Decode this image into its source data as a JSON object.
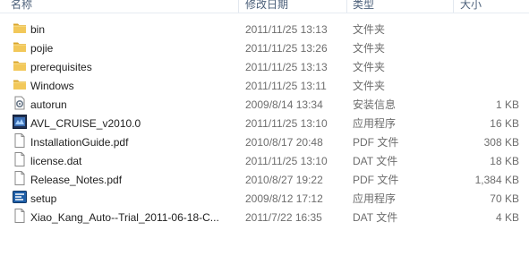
{
  "columns": {
    "name": "名称",
    "date": "修改日期",
    "type": "类型",
    "size": "大小"
  },
  "files": [
    {
      "name": "bin",
      "date": "2011/11/25 13:13",
      "type": "文件夹",
      "size": "",
      "icon": "folder-icon"
    },
    {
      "name": "pojie",
      "date": "2011/11/25 13:26",
      "type": "文件夹",
      "size": "",
      "icon": "folder-icon"
    },
    {
      "name": "prerequisites",
      "date": "2011/11/25 13:13",
      "type": "文件夹",
      "size": "",
      "icon": "folder-icon"
    },
    {
      "name": "Windows",
      "date": "2011/11/25 13:11",
      "type": "文件夹",
      "size": "",
      "icon": "folder-icon"
    },
    {
      "name": "autorun",
      "date": "2009/8/14 13:34",
      "type": "安装信息",
      "size": "1 KB",
      "icon": "setup-info-icon"
    },
    {
      "name": "AVL_CRUISE_v2010.0",
      "date": "2011/11/25 13:10",
      "type": "应用程序",
      "size": "16 KB",
      "icon": "application-icon"
    },
    {
      "name": "InstallationGuide.pdf",
      "date": "2010/8/17 20:48",
      "type": "PDF 文件",
      "size": "308 KB",
      "icon": "document-icon"
    },
    {
      "name": "license.dat",
      "date": "2011/11/25 13:10",
      "type": "DAT 文件",
      "size": "18 KB",
      "icon": "document-icon"
    },
    {
      "name": "Release_Notes.pdf",
      "date": "2010/8/27 19:22",
      "type": "PDF 文件",
      "size": "1,384 KB",
      "icon": "document-icon"
    },
    {
      "name": "setup",
      "date": "2009/8/12 17:12",
      "type": "应用程序",
      "size": "70 KB",
      "icon": "setup-icon"
    },
    {
      "name": "Xiao_Kang_Auto--Trial_2011-06-18-C...",
      "date": "2011/7/22 16:35",
      "type": "DAT 文件",
      "size": "4 KB",
      "icon": "document-icon"
    }
  ],
  "colors": {
    "folder": "#e8b93d",
    "header_text": "#4c607a",
    "secondary_text": "#6d6d6d"
  }
}
